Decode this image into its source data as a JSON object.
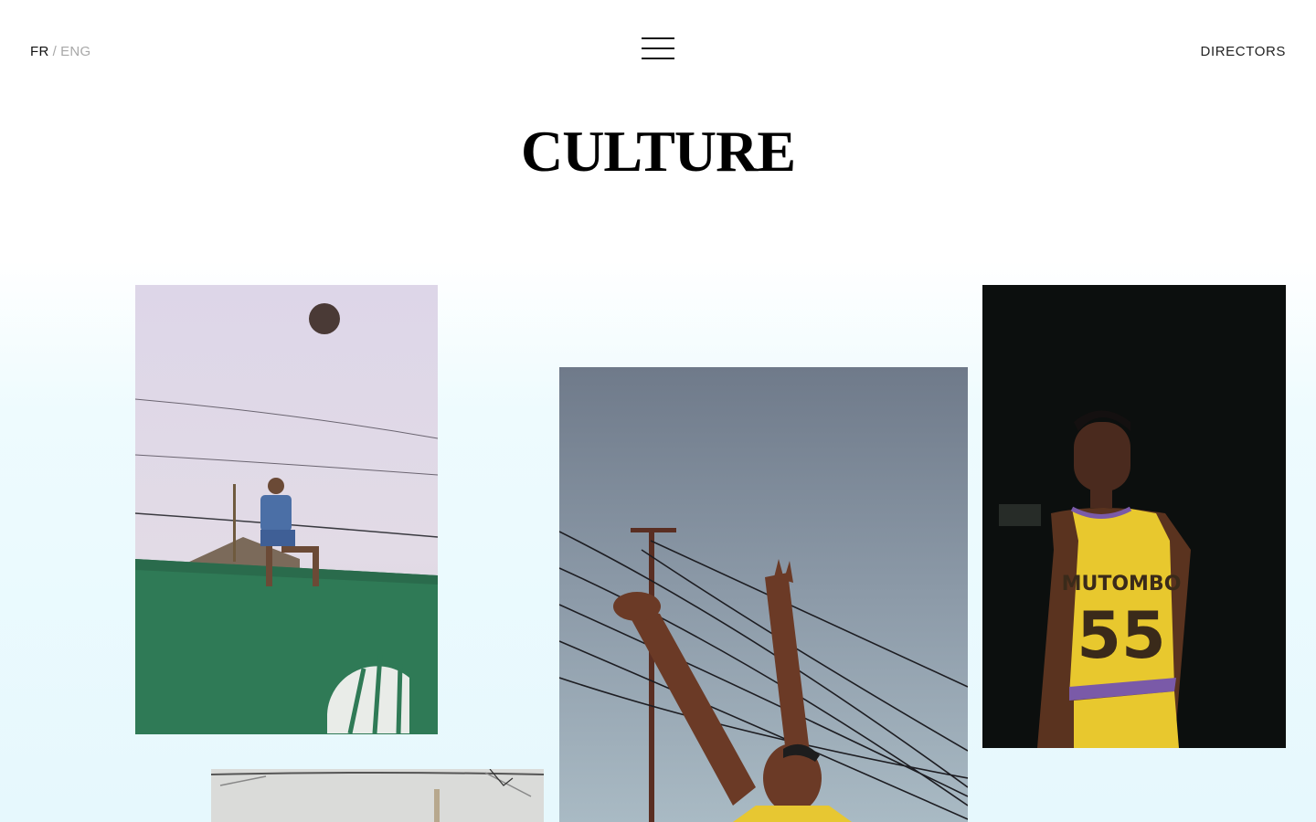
{
  "header": {
    "lang_active": "FR",
    "lang_separator": "/",
    "lang_inactive": "ENG",
    "menu_icon": "hamburger-menu-icon",
    "nav_link": "DIRECTORS"
  },
  "page": {
    "title": "CULTURE"
  },
  "gallery": {
    "photos": [
      {
        "subject": "boy-sitting-on-wall-with-ball"
      },
      {
        "subject": "player-reaching-up-under-wires"
      },
      {
        "subject": "player-in-mutombo-55-jersey",
        "jersey_name": "MUTOMBO",
        "jersey_number": "55"
      },
      {
        "subject": "ceiling-interior"
      }
    ]
  },
  "colors": {
    "background_gradient_end": "#e6f8fd",
    "text": "#111111",
    "muted": "#a8a8a8"
  }
}
